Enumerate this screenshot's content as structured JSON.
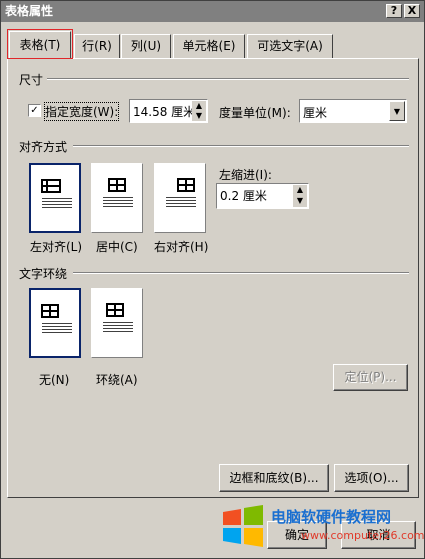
{
  "window": {
    "title": "表格属性",
    "help_label": "?",
    "close_label": "X"
  },
  "tabs": [
    {
      "label": "表格(T)",
      "active": true
    },
    {
      "label": "行(R)",
      "active": false
    },
    {
      "label": "列(U)",
      "active": false
    },
    {
      "label": "单元格(E)",
      "active": false
    },
    {
      "label": "可选文字(A)",
      "active": false
    }
  ],
  "size": {
    "group_label": "尺寸",
    "specify_width_label": "指定宽度(W):",
    "specify_width_checked": true,
    "width_value": "14.58 厘米",
    "measure_in_label": "度量单位(M):",
    "measure_in_value": "厘米"
  },
  "alignment": {
    "group_label": "对齐方式",
    "options": [
      {
        "label": "左对齐(L)",
        "selected": true
      },
      {
        "label": "居中(C)",
        "selected": false
      },
      {
        "label": "右对齐(H)",
        "selected": false
      }
    ],
    "indent_label": "左缩进(I):",
    "indent_value": "0.2 厘米"
  },
  "text_wrapping": {
    "group_label": "文字环绕",
    "options": [
      {
        "label": "无(N)",
        "selected": true
      },
      {
        "label": "环绕(A)",
        "selected": false
      }
    ],
    "positioning_label": "定位(P)..."
  },
  "footer": {
    "borders_label": "边框和底纹(B)...",
    "options_label": "选项(O)...",
    "ok_label": "确定",
    "cancel_label": "取消"
  },
  "watermark": {
    "title": "电脑软硬件教程网",
    "url": "www.computer26.com"
  },
  "colors": {
    "selection_outline": "#e0262a",
    "selected_border": "#0a246a"
  }
}
